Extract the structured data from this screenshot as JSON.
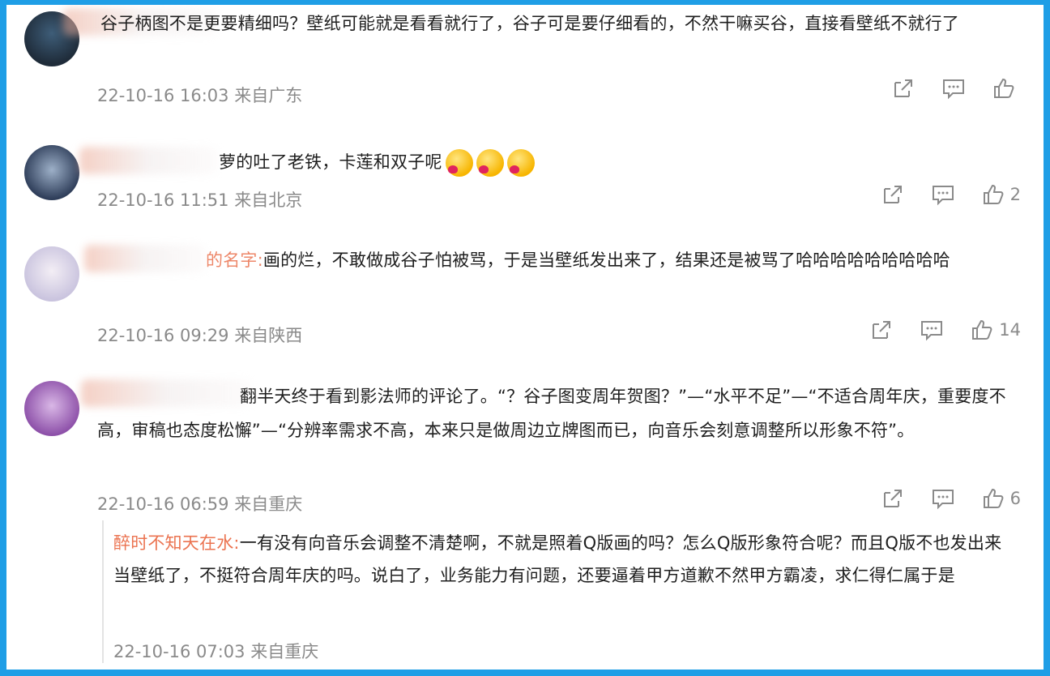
{
  "comments": [
    {
      "text": "谷子柄图不是更要精细吗？壁纸可能就是看看就行了，谷子可是要仔细看的，不然干嘛买谷，直接看壁纸不就行了",
      "meta": "22-10-16 16:03 来自广东",
      "likes": ""
    },
    {
      "text": "萝的吐了老铁，卡莲和双子呢",
      "meta": "22-10-16 11:51 来自北京",
      "likes": "2"
    },
    {
      "text": "画的烂，不敢做成谷子怕被骂，于是当壁纸发出来了，结果还是被骂了哈哈哈哈哈哈哈哈哈",
      "name_suffix": "的名字:",
      "meta": "22-10-16 09:29 来自陕西",
      "likes": "14"
    },
    {
      "text": "翻半天终于看到影法师的评论了。“？谷子图变周年贺图？”—“水平不足”—“不适合周年庆，重要度不高，审稿也态度松懈”—“分辨率需求不高，本来只是做周边立牌图而已，向音乐会刻意调整所以形象不符”。",
      "meta": "22-10-16 06:59 来自重庆",
      "likes": "6"
    }
  ],
  "reply": {
    "name": "醉时不知天在水:",
    "text": "一有没有向音乐会调整不清楚啊，不就是照着Q版画的吗？怎么Q版形象符合呢？而且Q版不也发出来当壁纸了，不挺符合周年庆的吗。说白了，业务能力有问题，还要逼着甲方道歉不然甲方霸凌，求仁得仁属于是",
    "meta": "22-10-16 07:03 来自重庆"
  },
  "icons": [
    "share-icon",
    "comment-icon",
    "like-icon"
  ],
  "colors": {
    "frame": "#1f9ee6",
    "meta": "#8a8a8a",
    "reply_name": "#eb7350"
  }
}
